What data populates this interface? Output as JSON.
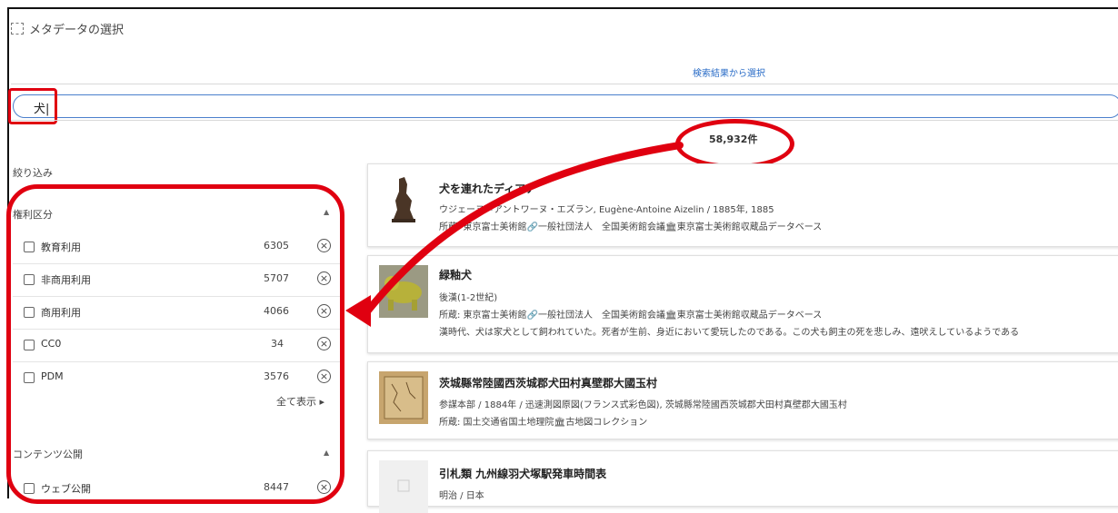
{
  "window": {
    "title": "メタデータの選択"
  },
  "tab": {
    "label": "検索結果から選択"
  },
  "search": {
    "value": "犬|"
  },
  "results": {
    "count": "58,932件"
  },
  "filters": {
    "label": "絞り込み",
    "rights": {
      "heading": "権利区分",
      "items": [
        {
          "label": "教育利用",
          "count": "6305"
        },
        {
          "label": "非商用利用",
          "count": "5707"
        },
        {
          "label": "商用利用",
          "count": "4066"
        },
        {
          "label": "CC0",
          "count": "34"
        },
        {
          "label": "PDM",
          "count": "3576"
        }
      ],
      "show_all": "全て表示 ▸"
    },
    "publication": {
      "heading": "コンテンツ公開",
      "items": [
        {
          "label": "ウェブ公開",
          "count": "8447"
        }
      ]
    }
  },
  "items": [
    {
      "title": "犬を連れたディアナ",
      "line1": "ウジェーヌ＝アントワーヌ・エズラン, Eugène-Antoine Aizelin / 1885年, 1885",
      "line2": "所蔵: 東京富士美術館🔗一般社団法人　全国美術館会議🏛東京富士美術館収蔵品データベース"
    },
    {
      "title": "緑釉犬",
      "line1": "後漢(1-2世紀)",
      "line2": "所蔵: 東京富士美術館🔗一般社団法人　全国美術館会議🏛東京富士美術館収蔵品データベース",
      "line3": "漢時代、犬は家犬として飼われていた。死者が生前、身近において愛玩したのである。この犬も飼主の死を悲しみ、遠吠えしているようである"
    },
    {
      "title": "茨城縣常陸國西茨城郡犬田村真壁郡大國玉村",
      "line1": "参謀本部 / 1884年 / 迅速測図原図(フランス式彩色図), 茨城縣常陸國西茨城郡犬田村真壁郡大國玉村",
      "line2": "所蔵: 国土交通省国土地理院🏛古地図コレクション"
    },
    {
      "title": "引札類 九州線羽犬塚駅発車時間表",
      "line1": "明治 / 日本"
    }
  ],
  "colors": {
    "annotation": "#e00010",
    "accent": "#2a6cc7"
  }
}
